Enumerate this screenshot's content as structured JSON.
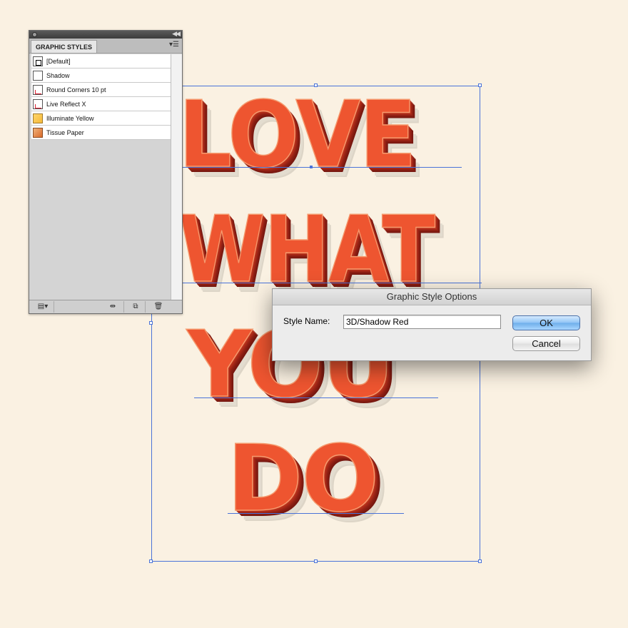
{
  "artwork": {
    "lines": [
      "LOVE",
      "WHAT",
      "YOU",
      "DO"
    ]
  },
  "panel": {
    "tab_label": "GRAPHIC STYLES",
    "menu_icon": "panel-menu-icon",
    "styles": [
      {
        "label": "[Default]",
        "icon": "default-style-icon"
      },
      {
        "label": "Shadow",
        "icon": "shadow-style-icon"
      },
      {
        "label": "Round Corners 10 pt",
        "icon": "round-corners-style-icon"
      },
      {
        "label": "Live Reflect X",
        "icon": "live-reflect-style-icon"
      },
      {
        "label": "Illuminate Yellow",
        "icon": "illuminate-yellow-style-icon"
      },
      {
        "label": "Tissue Paper",
        "icon": "tissue-paper-style-icon"
      }
    ]
  },
  "dialog": {
    "title": "Graphic Style Options",
    "style_name_label": "Style Name:",
    "style_name_value": "3D/Shadow Red",
    "ok_label": "OK",
    "cancel_label": "Cancel"
  },
  "colors": {
    "canvas": "#faf1e2",
    "letter_fill": "#ee5530",
    "letter_extrude": "#8a1f12",
    "selection": "#4a73d8",
    "ok_button": "#8fc3f5"
  }
}
